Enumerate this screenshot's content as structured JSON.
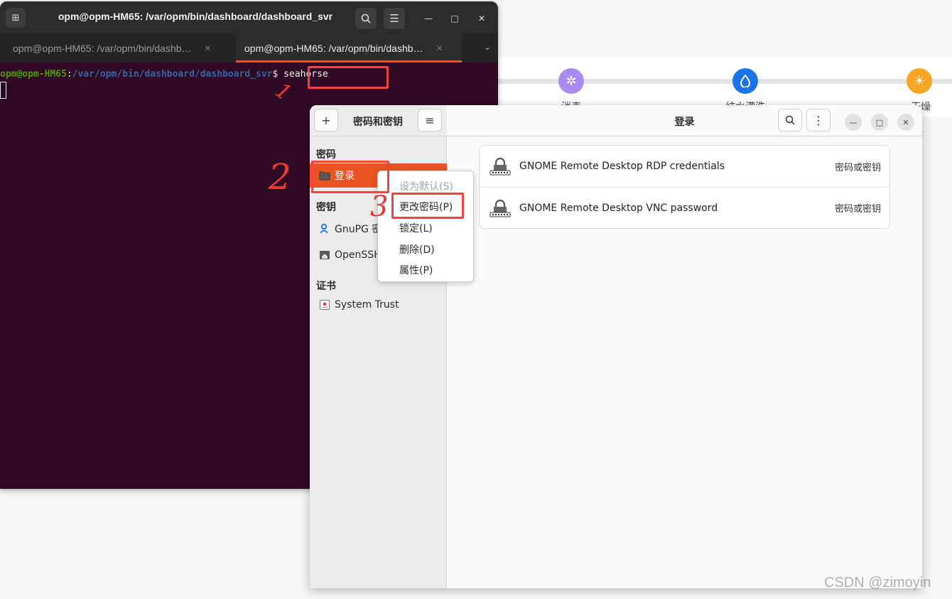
{
  "background_page": {
    "steps": [
      {
        "label": "消毒",
        "icon": "sun-icon",
        "color": "#a98bf0"
      },
      {
        "label": "纯水灌洗",
        "icon": "water-drop-icon",
        "color": "#1a73e8"
      },
      {
        "label": "干燥",
        "icon": "sun-icon",
        "color": "#f5a623"
      }
    ]
  },
  "terminal": {
    "title": "opm@opm-HM65: /var/opm/bin/dashboard/dashboard_svr",
    "tabs": [
      {
        "label": "opm@opm-HM65: /var/opm/bin/dashb…",
        "active": false
      },
      {
        "label": "opm@opm-HM65: /var/opm/bin/dashb…",
        "active": true
      }
    ],
    "prompt_user": "opm@opm-HM65",
    "prompt_sep": ":",
    "prompt_path": "/var/opm/bin/dashboard/dashboard_svr",
    "prompt_dollar": "$ ",
    "command": "seahorse"
  },
  "seahorse": {
    "sidebar_title": "密码和密钥",
    "main_title": "登录",
    "sections": {
      "passwords": "密码",
      "keys": "密钥",
      "certificates": "证书"
    },
    "sidebar_items": {
      "login": "登录",
      "gnupg": "GnuPG 密",
      "openssh": "OpenSSH",
      "system_trust": "System Trust"
    },
    "entries": [
      {
        "name": "GNOME Remote Desktop RDP credentials",
        "type": "密码或密钥"
      },
      {
        "name": "GNOME Remote Desktop VNC password",
        "type": "密码或密钥"
      }
    ]
  },
  "context_menu": {
    "items": [
      {
        "label": "设为默认(S)",
        "enabled": false
      },
      {
        "label": "更改密码(P)",
        "enabled": true
      },
      {
        "label": "锁定(L)",
        "enabled": true
      },
      {
        "label": "删除(D)",
        "enabled": true
      },
      {
        "label": "属性(P)",
        "enabled": true
      }
    ]
  },
  "annotations": {
    "step1": "1",
    "step2": "2",
    "step3": "3"
  },
  "watermark": "CSDN @zimoyin",
  "colors": {
    "terminal_bg": "#300a24",
    "accent_orange": "#e95420",
    "highlight_red": "#ee4444",
    "prompt_green": "#4e9a06",
    "prompt_blue": "#3465a4"
  }
}
